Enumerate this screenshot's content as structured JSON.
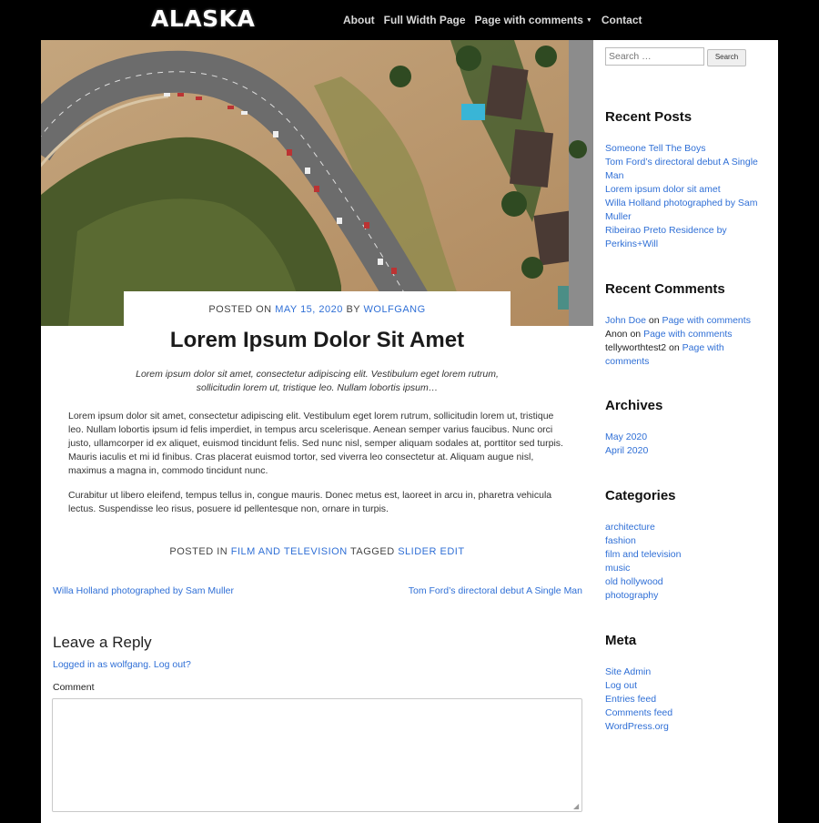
{
  "header": {
    "logo": "ALASKA",
    "nav": [
      {
        "label": "About"
      },
      {
        "label": "Full Width Page"
      },
      {
        "label": "Page with comments",
        "has_dropdown": true
      },
      {
        "label": "Contact"
      }
    ]
  },
  "post": {
    "meta": {
      "posted_on": "POSTED ON",
      "date": "MAY 15, 2020",
      "by": "BY",
      "author": "WOLFGANG"
    },
    "title": "Lorem Ipsum Dolor Sit Amet",
    "excerpt": "Lorem ipsum dolor sit amet, consectetur adipiscing elit. Vestibulum eget lorem rutrum, sollicitudin lorem ut, tristique leo. Nullam lobortis ipsum…",
    "paragraphs": [
      "Lorem ipsum dolor sit amet, consectetur adipiscing elit. Vestibulum eget lorem rutrum, sollicitudin lorem ut, tristique leo. Nullam lobortis ipsum id felis imperdiet, in tempus arcu scelerisque. Aenean semper varius faucibus. Nunc orci justo, ullamcorper id ex aliquet, euismod tincidunt felis. Sed nunc nisl, semper aliquam sodales at, porttitor sed turpis. Mauris iaculis et mi id finibus. Cras placerat euismod tortor, sed viverra leo consectetur at. Aliquam augue nisl, maximus a magna in, commodo tincidunt nunc.",
      "Curabitur ut libero eleifend, tempus tellus in, congue mauris. Donec metus est, laoreet in arcu in, pharetra vehicula lectus. Suspendisse leo risus, posuere id pellentesque non, ornare in turpis."
    ],
    "footer": {
      "posted_in": "POSTED IN",
      "category": "FILM AND TELEVISION",
      "tagged": "TAGGED",
      "tags": "SLIDER EDIT"
    },
    "nav_prev": "Willa Holland photographed by Sam Muller",
    "nav_next": "Tom Ford’s directoral debut A Single Man"
  },
  "reply": {
    "title": "Leave a Reply",
    "logged_in": "Logged in as wolfgang.",
    "log_out": "Log out?",
    "comment_label": "Comment"
  },
  "sidebar": {
    "search": {
      "placeholder": "Search …",
      "button": "Search"
    },
    "recent_posts": {
      "title": "Recent Posts",
      "items": [
        "Someone Tell The Boys",
        "Tom Ford’s directoral debut A Single Man",
        "Lorem ipsum dolor sit amet",
        "Willa Holland photographed by Sam Muller",
        "Ribeirao Preto Residence by Perkins+Will"
      ]
    },
    "recent_comments": {
      "title": "Recent Comments",
      "items": [
        {
          "author": "John Doe",
          "author_link": true,
          "on": "on",
          "post": "Page with comments"
        },
        {
          "author": "Anon",
          "author_link": false,
          "on": "on",
          "post": "Page with comments"
        },
        {
          "author": "tellyworthtest2",
          "author_link": false,
          "on": "on",
          "post": "Page with comments"
        }
      ]
    },
    "archives": {
      "title": "Archives",
      "items": [
        "May 2020",
        "April 2020"
      ]
    },
    "categories": {
      "title": "Categories",
      "items": [
        "architecture",
        "fashion",
        "film and television",
        "music",
        "old hollywood",
        "photography"
      ]
    },
    "meta": {
      "title": "Meta",
      "items": [
        "Site Admin",
        "Log out",
        "Entries feed",
        "Comments feed",
        "WordPress.org"
      ]
    }
  },
  "colors": {
    "link": "#2f6fd6",
    "background": "#000000",
    "panel": "#ffffff"
  }
}
